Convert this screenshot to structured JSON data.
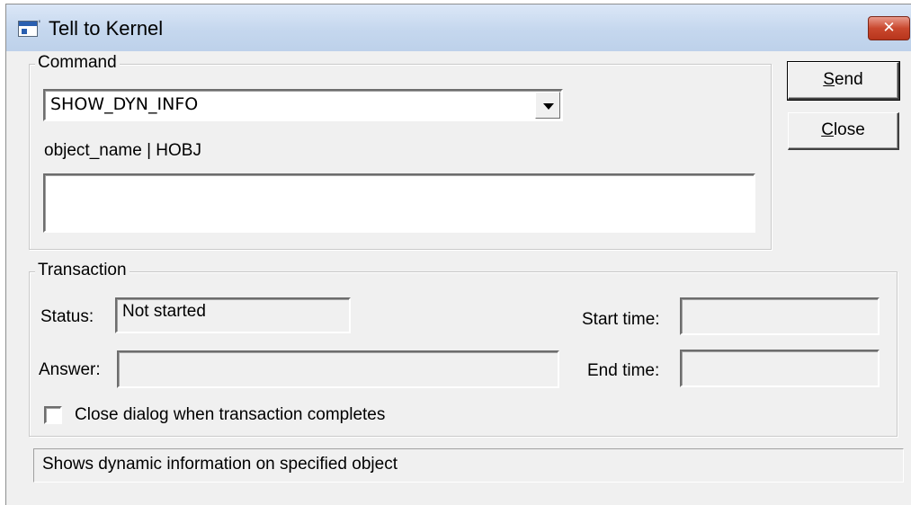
{
  "window": {
    "title": "Tell to Kernel",
    "close_glyph": "✕"
  },
  "command_group": {
    "legend": "Command",
    "combo_value": "SHOW_DYN_INFO",
    "param_label": "object_name | HOBJ",
    "param_value": ""
  },
  "buttons": {
    "send_mnemonic": "S",
    "send_rest": "end",
    "close_mnemonic": "C",
    "close_rest": "lose"
  },
  "transaction_group": {
    "legend": "Transaction",
    "status_label": "Status:",
    "status_value": "Not started",
    "answer_label": "Answer:",
    "answer_value": "",
    "start_time_label": "Start time:",
    "start_time_value": "",
    "end_time_label": "End time:",
    "end_time_value": "",
    "checkbox_label": "Close dialog when transaction completes",
    "checkbox_checked": false
  },
  "status_bar": {
    "text": "Shows dynamic information on specified object"
  },
  "icons": {
    "window_icon": "application-icon",
    "combo_arrow": "chevron-down-icon",
    "close": "close-icon"
  }
}
